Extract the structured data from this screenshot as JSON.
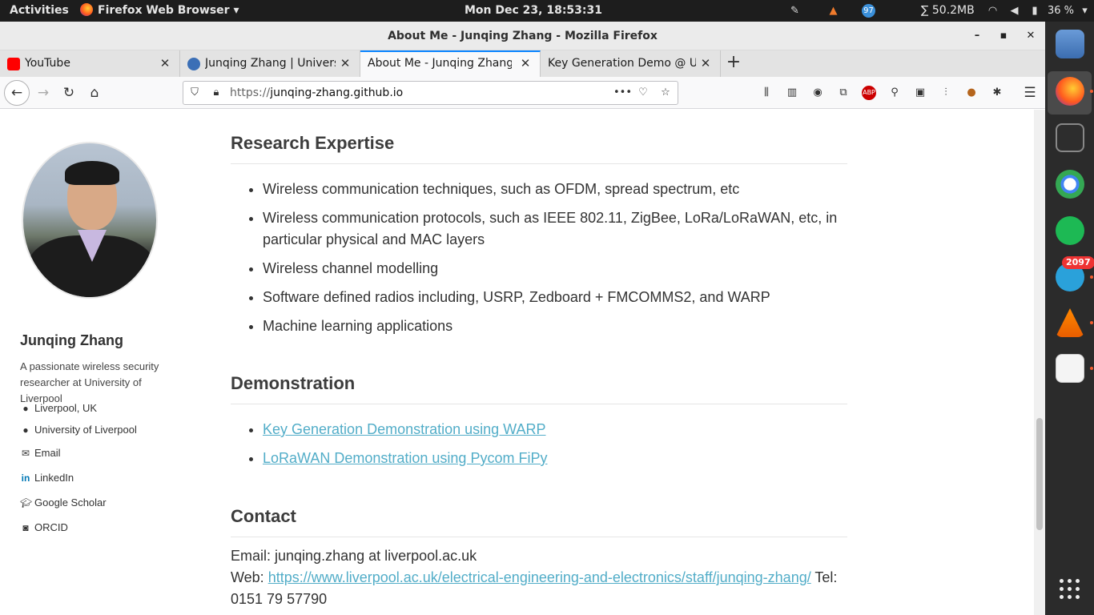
{
  "topbar": {
    "activities": "Activities",
    "app_menu": "Firefox Web Browser ▾",
    "clock": "Mon Dec 23, 18:53:31",
    "mem": "∑ 50.2MB",
    "battery": "36 %",
    "weather_badge": "97"
  },
  "window": {
    "title": "About Me - Junqing Zhang - Mozilla Firefox"
  },
  "tabs": [
    {
      "label": "YouTube",
      "favicon_color": "#ff0000"
    },
    {
      "label": "Junqing Zhang | Universi",
      "favicon_color": "#3b6fb6"
    },
    {
      "label": "About Me - Junqing Zhang",
      "favicon_color": "#f9f9fa"
    },
    {
      "label": "Key Generation Demo @ Un",
      "favicon_color": "#e3e3e3"
    }
  ],
  "urlbar": {
    "scheme": "https://",
    "host": "junqing-zhang.github.io"
  },
  "sidebar": {
    "name": "Junqing Zhang",
    "bio": "A passionate wireless security researcher at University of Liverpool",
    "links": [
      {
        "label": "Liverpool, UK",
        "icon": "map-marker-icon"
      },
      {
        "label": "University of Liverpool",
        "icon": "map-marker-icon"
      },
      {
        "label": "Email",
        "icon": "envelope-icon"
      },
      {
        "label": "LinkedIn",
        "icon": "linkedin-icon"
      },
      {
        "label": "Google Scholar",
        "icon": "graduation-cap-icon"
      },
      {
        "label": "ORCID",
        "icon": "orcid-icon"
      }
    ]
  },
  "sections": {
    "research": {
      "title": "Research Expertise",
      "items": [
        "Wireless communication techniques, such as OFDM, spread spectrum, etc",
        "Wireless communication protocols, such as IEEE 802.11, ZigBee, LoRa/LoRaWAN, etc, in particular physical and MAC layers",
        "Wireless channel modelling",
        "Software defined radios including, USRP, Zedboard + FMCOMMS2, and WARP",
        "Machine learning applications"
      ]
    },
    "demonstration": {
      "title": "Demonstration",
      "items": [
        "Key Generation Demonstration using WARP",
        "LoRaWAN Demonstration using Pycom FiPy"
      ]
    },
    "contact": {
      "title": "Contact",
      "email": "Email: junqing.zhang at liverpool.ac.uk",
      "web_prefix": "Web: ",
      "web_link": "https://www.liverpool.ac.uk/electrical-engineering-and-electronics/staff/junqing-zhang/",
      "tel": " Tel: 0151 79 57790"
    }
  },
  "dock": {
    "telegram_badge": "2097"
  },
  "colors": {
    "link": "#52adc8",
    "accent": "#0a84ff"
  }
}
